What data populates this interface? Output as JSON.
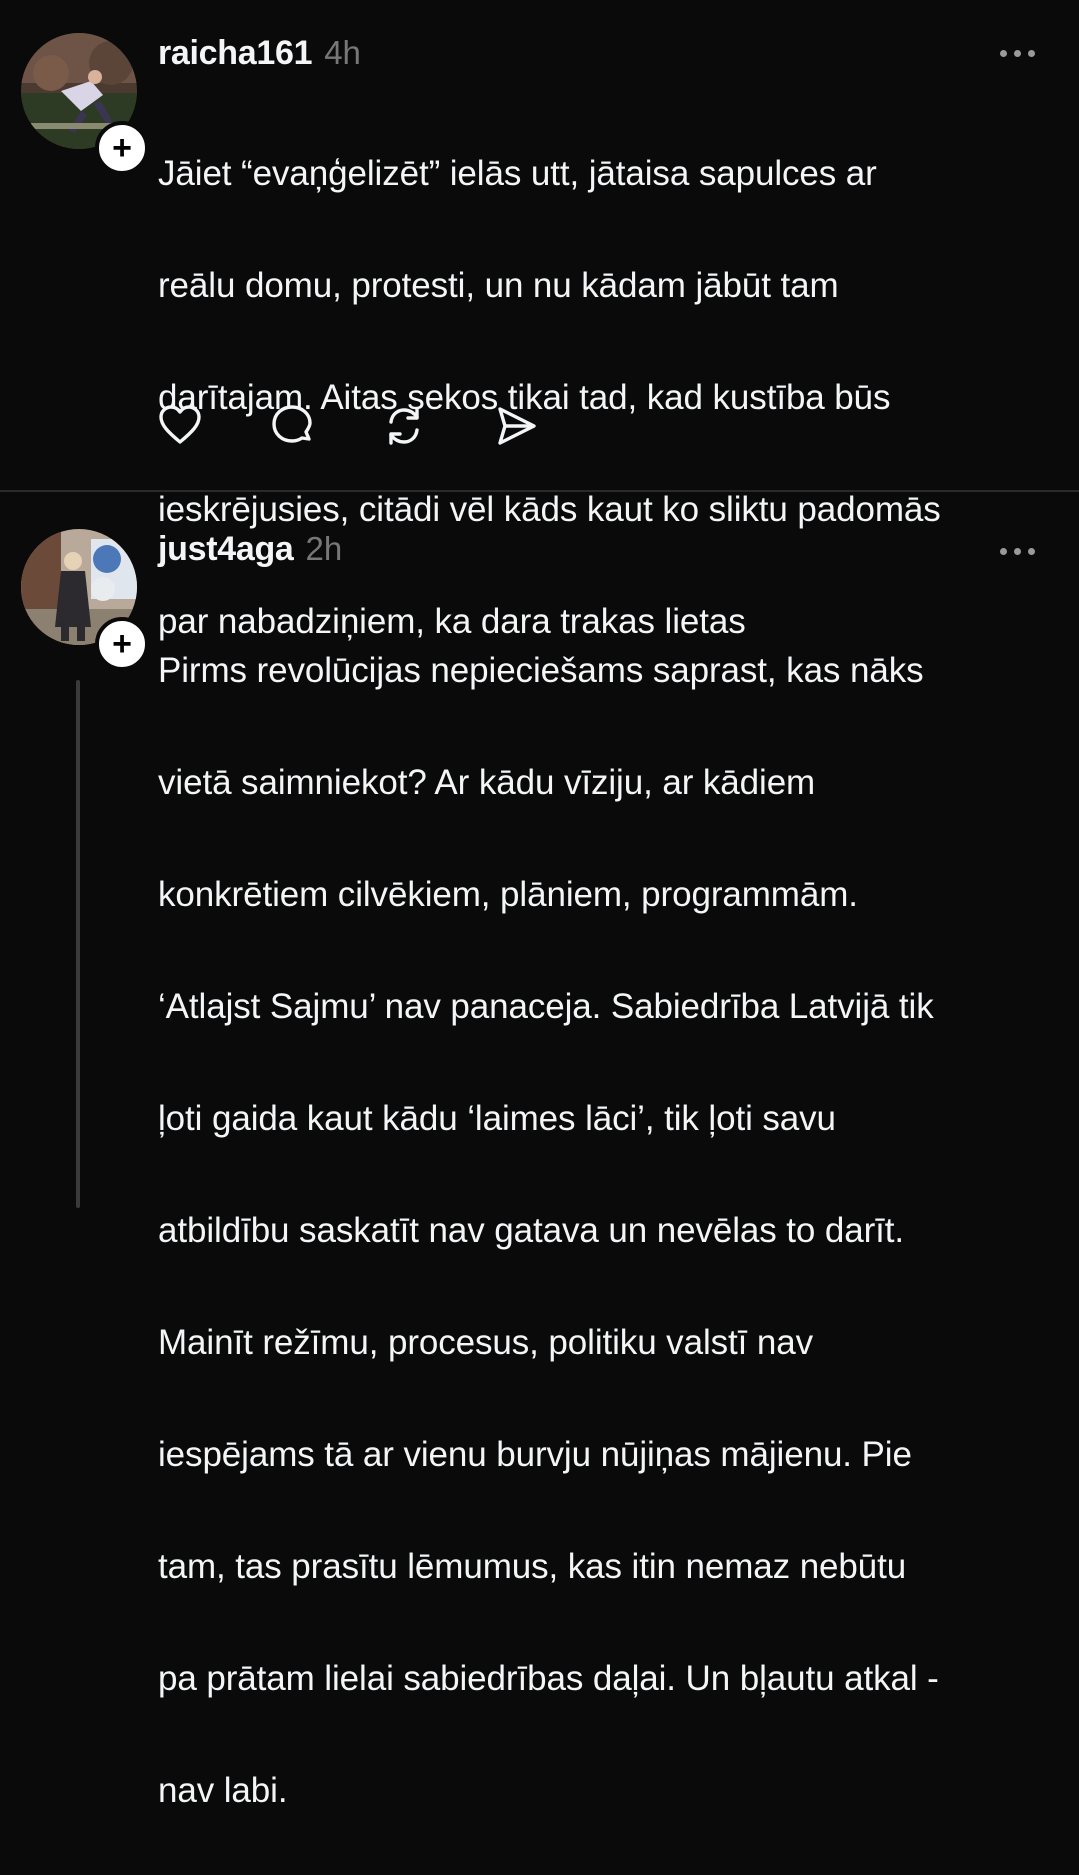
{
  "posts": [
    {
      "username": "raicha161",
      "time": "4h",
      "lines": [
        "Jāiet “evaņģelizēt” ielās utt, jātaisa sapulces ar",
        "reālu domu, protesti, un nu kādam jābūt tam",
        "darītajam. Aitas sekos tikai tad, kad kustība būs",
        "ieskrējusies, citādi vēl kāds kaut ko sliktu padomās",
        "par nabadziņiem, ka dara trakas lietas"
      ],
      "follow_label": "+",
      "icons": [
        "avatar-photo",
        "plus-icon",
        "more-icon",
        "heart-icon",
        "comment-icon",
        "repost-icon",
        "share-icon"
      ]
    },
    {
      "username": "just4aga",
      "time": "2h",
      "lines": [
        "Pirms revolūcijas nepieciešams saprast, kas nāks",
        "vietā saimniekot? Ar kādu vīziju, ar kādiem",
        "konkrētiem cilvēkiem, plāniem, programmām.",
        "‘Atlajst Sajmu’ nav panaceja. Sabiedrība Latvijā tik",
        "ļoti gaida kaut kādu ‘laimes lāci’, tik ļoti savu",
        "atbildību saskatīt nav gatava un nevēlas to darīt.",
        "Mainīt režīmu, procesus, politiku valstī nav",
        "iespējams tā ar vienu burvju nūjiņas mājienu. Pie",
        "tam, tas prasītu lēmumus, kas itin nemaz nebūtu",
        "pa prātam lielai sabiedrības daļai. Un bļautu atkal -",
        "nav labi."
      ],
      "follow_label": "+",
      "icons": [
        "avatar-photo",
        "plus-icon",
        "more-icon",
        "thread-line"
      ]
    }
  ],
  "colors": {
    "background": "#0a0a0a",
    "text": "#f3f5f7",
    "muted": "#777777",
    "divider": "#2a2a2a"
  }
}
